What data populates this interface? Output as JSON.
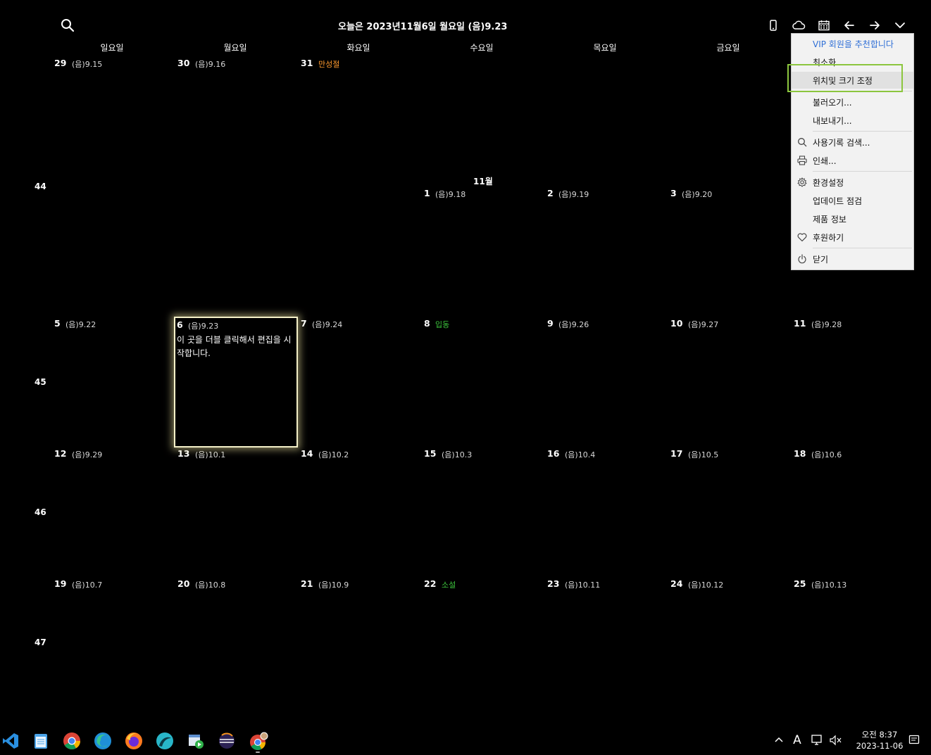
{
  "header": {
    "today_text": "오늘은 2023년11월6일 월요일 (음)9.23"
  },
  "toolbar": {
    "icons": [
      "phone-icon",
      "cloud-icon",
      "calendar-icon",
      "arrow-left-icon",
      "arrow-right-icon",
      "chevron-down-icon"
    ]
  },
  "weekdays": [
    "일요일",
    "월요일",
    "화요일",
    "수요일",
    "목요일",
    "금요일"
  ],
  "weeks": [
    {
      "num": "",
      "days": [
        {
          "d": "29",
          "lunar": "(음)9.15",
          "hol": ""
        },
        {
          "d": "30",
          "lunar": "(음)9.16",
          "hol": ""
        },
        {
          "d": "31",
          "lunar": "",
          "hol": "만성절"
        },
        {
          "d": "",
          "lunar": "",
          "hol": ""
        },
        {
          "d": "",
          "lunar": "",
          "hol": ""
        },
        {
          "d": "",
          "lunar": "",
          "hol": ""
        },
        {
          "d": "",
          "lunar": "",
          "hol": ""
        }
      ]
    },
    {
      "num": "44",
      "days": [
        {
          "d": "",
          "lunar": "",
          "hol": ""
        },
        {
          "d": "",
          "lunar": "",
          "hol": ""
        },
        {
          "d": "",
          "lunar": "",
          "hol": ""
        },
        {
          "d": "1",
          "lunar": "(음)9.18",
          "hol": ""
        },
        {
          "d": "2",
          "lunar": "(음)9.19",
          "hol": ""
        },
        {
          "d": "3",
          "lunar": "(음)9.20",
          "hol": ""
        },
        {
          "d": "",
          "lunar": "",
          "hol": ""
        }
      ]
    },
    {
      "num": "45",
      "days": [
        {
          "d": "5",
          "lunar": "(음)9.22",
          "hol": ""
        },
        {
          "d": "",
          "lunar": "",
          "hol": ""
        },
        {
          "d": "7",
          "lunar": "(음)9.24",
          "hol": ""
        },
        {
          "d": "8",
          "lunar": "",
          "hol": "입동"
        },
        {
          "d": "9",
          "lunar": "(음)9.26",
          "hol": ""
        },
        {
          "d": "10",
          "lunar": "(음)9.27",
          "hol": ""
        },
        {
          "d": "11",
          "lunar": "(음)9.28",
          "hol": ""
        }
      ]
    },
    {
      "num": "46",
      "days": [
        {
          "d": "12",
          "lunar": "(음)9.29",
          "hol": ""
        },
        {
          "d": "13",
          "lunar": "(음)10.1",
          "hol": ""
        },
        {
          "d": "14",
          "lunar": "(음)10.2",
          "hol": ""
        },
        {
          "d": "15",
          "lunar": "(음)10.3",
          "hol": ""
        },
        {
          "d": "16",
          "lunar": "(음)10.4",
          "hol": ""
        },
        {
          "d": "17",
          "lunar": "(음)10.5",
          "hol": ""
        },
        {
          "d": "18",
          "lunar": "(음)10.6",
          "hol": ""
        }
      ]
    },
    {
      "num": "47",
      "days": [
        {
          "d": "19",
          "lunar": "(음)10.7",
          "hol": ""
        },
        {
          "d": "20",
          "lunar": "(음)10.8",
          "hol": ""
        },
        {
          "d": "21",
          "lunar": "(음)10.9",
          "hol": ""
        },
        {
          "d": "22",
          "lunar": "",
          "hol": "소설"
        },
        {
          "d": "23",
          "lunar": "(음)10.11",
          "hol": ""
        },
        {
          "d": "24",
          "lunar": "(음)10.12",
          "hol": ""
        },
        {
          "d": "25",
          "lunar": "(음)10.13",
          "hol": ""
        }
      ]
    }
  ],
  "month_label": "11월",
  "today_cell": {
    "d": "6",
    "lunar": "(음)9.23",
    "memo": "이 곳을 더블 클릭해서 편집을 시작합니다."
  },
  "colors": {
    "background": "#000000",
    "today_border": "#f4f0c8",
    "holiday_orange": "#ff9a2e",
    "holiday_green": "#3cc43c",
    "highlight_box": "#8cc63e",
    "vip_link": "#2f6fd6"
  },
  "menu": {
    "vip": "VIP 회원을 추천합니다",
    "minimize": "최소화",
    "position_size": "위치및 크기 조정",
    "import": "불러오기...",
    "export": "내보내기...",
    "history_search": "사용기록 검색...",
    "print": "인쇄...",
    "settings": "환경설정",
    "update_check": "업데이트 점검",
    "product_info": "제품 정보",
    "donate": "후원하기",
    "close": "닫기"
  },
  "taskbar": {
    "apps": [
      "vscode-icon",
      "notepad-icon",
      "chrome-icon",
      "edge-icon",
      "firefox-icon",
      "browser-icon",
      "media-icon",
      "eclipse-icon",
      "chrome-profile-icon"
    ],
    "ime": "A",
    "time": "오전 8:37",
    "date": "2023-11-06"
  }
}
